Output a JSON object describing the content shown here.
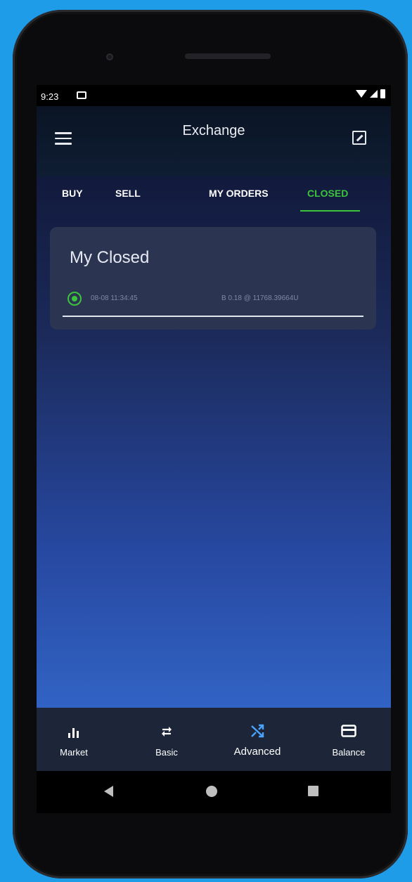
{
  "status_bar": {
    "time": "9:23"
  },
  "app_bar": {
    "title": "Exchange"
  },
  "tabs": [
    {
      "label": "BUY"
    },
    {
      "label": "SELL"
    },
    {
      "label": "MY ORDERS"
    },
    {
      "label": "CLOSED",
      "active": true
    }
  ],
  "card": {
    "title": "My Closed",
    "orders": [
      {
        "time": "08-08 11:34:45",
        "detail": "B 0.18 @ 11768.39664U",
        "selected": true
      }
    ]
  },
  "bottom_nav": [
    {
      "label": "Market",
      "icon": "bar-chart-icon"
    },
    {
      "label": "Basic",
      "icon": "swap-arrows-icon"
    },
    {
      "label": "Advanced",
      "icon": "shuffle-icon",
      "active": true
    },
    {
      "label": "Balance",
      "icon": "credit-card-icon"
    }
  ],
  "colors": {
    "accent_green": "#3cc33c",
    "active_nav_blue": "#4aa3ff",
    "background": "#1e9ce8"
  }
}
